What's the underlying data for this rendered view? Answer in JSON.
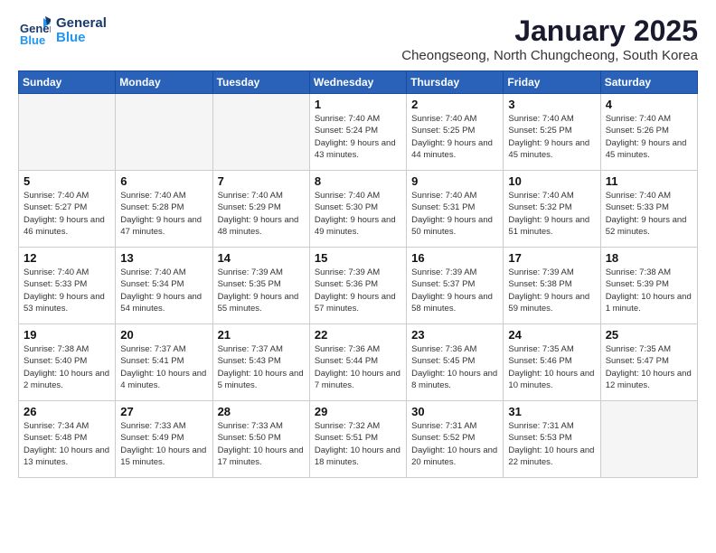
{
  "logo": {
    "line1": "General",
    "line2": "Blue"
  },
  "title": "January 2025",
  "location": "Cheongseong, North Chungcheong, South Korea",
  "weekdays": [
    "Sunday",
    "Monday",
    "Tuesday",
    "Wednesday",
    "Thursday",
    "Friday",
    "Saturday"
  ],
  "weeks": [
    [
      {
        "day": "",
        "empty": true
      },
      {
        "day": "",
        "empty": true
      },
      {
        "day": "",
        "empty": true
      },
      {
        "day": "1",
        "sunrise": "7:40 AM",
        "sunset": "5:24 PM",
        "daylight": "9 hours and 43 minutes."
      },
      {
        "day": "2",
        "sunrise": "7:40 AM",
        "sunset": "5:25 PM",
        "daylight": "9 hours and 44 minutes."
      },
      {
        "day": "3",
        "sunrise": "7:40 AM",
        "sunset": "5:25 PM",
        "daylight": "9 hours and 45 minutes."
      },
      {
        "day": "4",
        "sunrise": "7:40 AM",
        "sunset": "5:26 PM",
        "daylight": "9 hours and 45 minutes."
      }
    ],
    [
      {
        "day": "5",
        "sunrise": "7:40 AM",
        "sunset": "5:27 PM",
        "daylight": "9 hours and 46 minutes."
      },
      {
        "day": "6",
        "sunrise": "7:40 AM",
        "sunset": "5:28 PM",
        "daylight": "9 hours and 47 minutes."
      },
      {
        "day": "7",
        "sunrise": "7:40 AM",
        "sunset": "5:29 PM",
        "daylight": "9 hours and 48 minutes."
      },
      {
        "day": "8",
        "sunrise": "7:40 AM",
        "sunset": "5:30 PM",
        "daylight": "9 hours and 49 minutes."
      },
      {
        "day": "9",
        "sunrise": "7:40 AM",
        "sunset": "5:31 PM",
        "daylight": "9 hours and 50 minutes."
      },
      {
        "day": "10",
        "sunrise": "7:40 AM",
        "sunset": "5:32 PM",
        "daylight": "9 hours and 51 minutes."
      },
      {
        "day": "11",
        "sunrise": "7:40 AM",
        "sunset": "5:33 PM",
        "daylight": "9 hours and 52 minutes."
      }
    ],
    [
      {
        "day": "12",
        "sunrise": "7:40 AM",
        "sunset": "5:33 PM",
        "daylight": "9 hours and 53 minutes."
      },
      {
        "day": "13",
        "sunrise": "7:40 AM",
        "sunset": "5:34 PM",
        "daylight": "9 hours and 54 minutes."
      },
      {
        "day": "14",
        "sunrise": "7:39 AM",
        "sunset": "5:35 PM",
        "daylight": "9 hours and 55 minutes."
      },
      {
        "day": "15",
        "sunrise": "7:39 AM",
        "sunset": "5:36 PM",
        "daylight": "9 hours and 57 minutes."
      },
      {
        "day": "16",
        "sunrise": "7:39 AM",
        "sunset": "5:37 PM",
        "daylight": "9 hours and 58 minutes."
      },
      {
        "day": "17",
        "sunrise": "7:39 AM",
        "sunset": "5:38 PM",
        "daylight": "9 hours and 59 minutes."
      },
      {
        "day": "18",
        "sunrise": "7:38 AM",
        "sunset": "5:39 PM",
        "daylight": "10 hours and 1 minute."
      }
    ],
    [
      {
        "day": "19",
        "sunrise": "7:38 AM",
        "sunset": "5:40 PM",
        "daylight": "10 hours and 2 minutes."
      },
      {
        "day": "20",
        "sunrise": "7:37 AM",
        "sunset": "5:41 PM",
        "daylight": "10 hours and 4 minutes."
      },
      {
        "day": "21",
        "sunrise": "7:37 AM",
        "sunset": "5:43 PM",
        "daylight": "10 hours and 5 minutes."
      },
      {
        "day": "22",
        "sunrise": "7:36 AM",
        "sunset": "5:44 PM",
        "daylight": "10 hours and 7 minutes."
      },
      {
        "day": "23",
        "sunrise": "7:36 AM",
        "sunset": "5:45 PM",
        "daylight": "10 hours and 8 minutes."
      },
      {
        "day": "24",
        "sunrise": "7:35 AM",
        "sunset": "5:46 PM",
        "daylight": "10 hours and 10 minutes."
      },
      {
        "day": "25",
        "sunrise": "7:35 AM",
        "sunset": "5:47 PM",
        "daylight": "10 hours and 12 minutes."
      }
    ],
    [
      {
        "day": "26",
        "sunrise": "7:34 AM",
        "sunset": "5:48 PM",
        "daylight": "10 hours and 13 minutes."
      },
      {
        "day": "27",
        "sunrise": "7:33 AM",
        "sunset": "5:49 PM",
        "daylight": "10 hours and 15 minutes."
      },
      {
        "day": "28",
        "sunrise": "7:33 AM",
        "sunset": "5:50 PM",
        "daylight": "10 hours and 17 minutes."
      },
      {
        "day": "29",
        "sunrise": "7:32 AM",
        "sunset": "5:51 PM",
        "daylight": "10 hours and 18 minutes."
      },
      {
        "day": "30",
        "sunrise": "7:31 AM",
        "sunset": "5:52 PM",
        "daylight": "10 hours and 20 minutes."
      },
      {
        "day": "31",
        "sunrise": "7:31 AM",
        "sunset": "5:53 PM",
        "daylight": "10 hours and 22 minutes."
      },
      {
        "day": "",
        "empty": true
      }
    ]
  ]
}
